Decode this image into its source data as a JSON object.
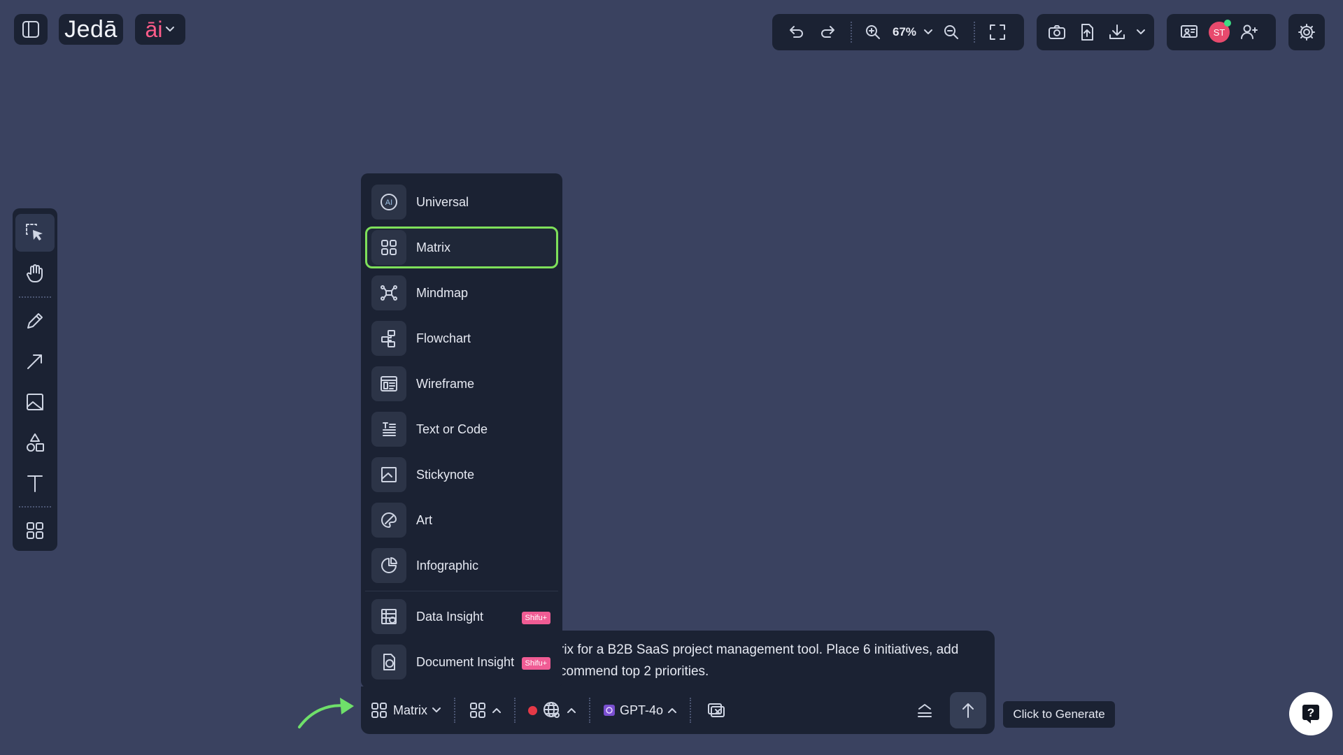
{
  "app": {
    "logo_text": "Jedā",
    "ai_label": "āi"
  },
  "toolbar": {
    "zoom_level": "67%"
  },
  "user": {
    "initials": "ST"
  },
  "menu": {
    "items": [
      {
        "label": "Universal",
        "icon": "ai-circle-icon"
      },
      {
        "label": "Matrix",
        "icon": "grid-icon",
        "selected": true
      },
      {
        "label": "Mindmap",
        "icon": "mindmap-icon"
      },
      {
        "label": "Flowchart",
        "icon": "flowchart-icon"
      },
      {
        "label": "Wireframe",
        "icon": "wireframe-icon"
      },
      {
        "label": "Text or Code",
        "icon": "text-code-icon"
      },
      {
        "label": "Stickynote",
        "icon": "stickynote-icon"
      },
      {
        "label": "Art",
        "icon": "palette-icon"
      },
      {
        "label": "Infographic",
        "icon": "pie-icon"
      },
      {
        "label": "Data Insight",
        "icon": "data-table-icon",
        "badge": "Shifu+"
      },
      {
        "label": "Document Insight",
        "icon": "document-icon",
        "badge": "Shifu+"
      }
    ]
  },
  "prompt": {
    "line1": "rix for a B2B SaaS project management tool. Place 6 initiatives, add",
    "line2": "commend top 2 priorities."
  },
  "bottom_bar": {
    "type_label": "Matrix",
    "model_label": "GPT-4o"
  },
  "tooltip": {
    "text": "Click to Generate"
  },
  "colors": {
    "background": "#3a4260",
    "panel": "#1b2233",
    "accent_pink": "#ff5c8a",
    "selected_border": "#7ee05a",
    "badge": "#f05c94"
  }
}
